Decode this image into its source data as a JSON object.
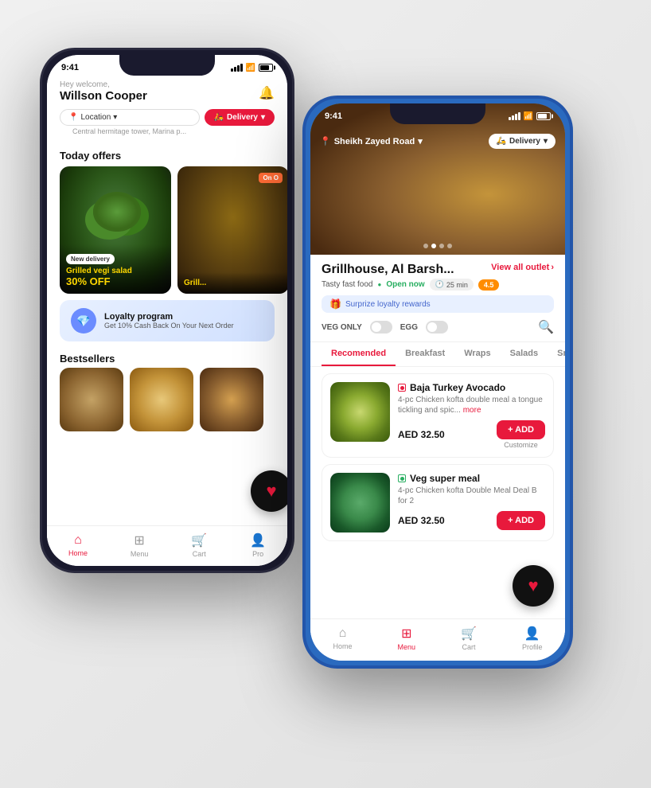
{
  "phone1": {
    "statusBar": {
      "time": "9:41",
      "signal": "●●●",
      "wifi": "WiFi",
      "battery": "Battery"
    },
    "header": {
      "greeting": "Hey welcome,",
      "userName": "Willson Cooper",
      "bellIcon": "🔔",
      "locationLabel": "Location",
      "locationSubtext": "Central hermitage tower, Marina p...",
      "deliveryLabel": "Delivery"
    },
    "todayOffers": {
      "sectionTitle": "Today offers",
      "card1": {
        "badge": "New delivery",
        "title": "Grilled vegi salad",
        "discount": "30% OFF"
      },
      "card2": {
        "badge": "On O",
        "title": "Grill..."
      }
    },
    "loyaltyBanner": {
      "title": "Loyalty program",
      "subtitle": "Get 10% Cash Back On Your Next Order"
    },
    "bestsellers": {
      "sectionTitle": "Bestsellers"
    },
    "bottomNav": {
      "home": "Home",
      "menu": "Menu",
      "cart": "Cart",
      "profile": "Pro"
    }
  },
  "phone2": {
    "statusBar": {
      "time": "9:41",
      "signal": "●●●",
      "wifi": "WiFi",
      "battery": "Battery"
    },
    "header": {
      "location": "Sheikh Zayed Road",
      "deliveryLabel": "Delivery"
    },
    "restaurant": {
      "name": "Grillhouse, Al Barsh...",
      "viewAllLabel": "View all outlet",
      "cuisine": "Tasty fast food",
      "openStatus": "Open now",
      "deliveryTime": "25 min",
      "rating": "4.5",
      "loyaltyTag": "Surprize loyalty rewards"
    },
    "filters": {
      "vegOnly": "VEG ONLY",
      "egg": "EGG"
    },
    "menuTabs": [
      "Recomended",
      "Breakfast",
      "Wraps",
      "Salads",
      "Sna"
    ],
    "menuItems": [
      {
        "name": "Baja Turkey Avocado",
        "description": "4-pc Chicken kofta double meal a tongue tickling and spic...",
        "moreLabel": "more",
        "price": "AED 32.50",
        "addLabel": "+ ADD",
        "customizeLabel": "Customize",
        "isVeg": false
      },
      {
        "name": "Veg super meal",
        "description": "4-pc Chicken kofta Double Meal Deal B for 2",
        "price": "AED 32.50",
        "addLabel": "+ ADD",
        "isVeg": true
      }
    ],
    "bottomNav": {
      "home": "Home",
      "menu": "Menu",
      "cart": "Cart",
      "profile": "Profile"
    }
  }
}
